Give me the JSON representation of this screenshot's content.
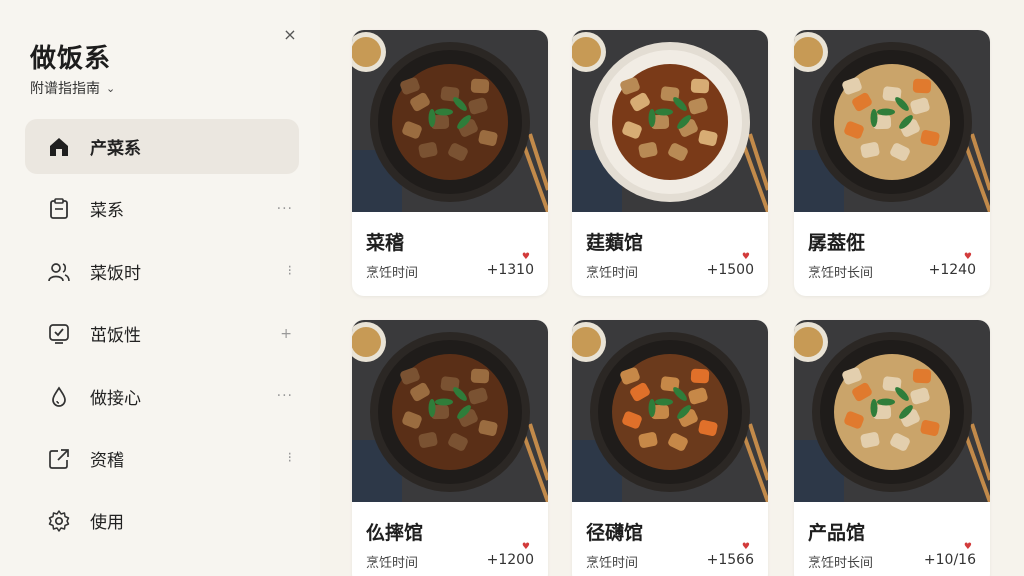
{
  "app": {
    "title": "做饭系",
    "subtitle": "附谱指指南",
    "close_glyph": "×"
  },
  "sidebar": {
    "items": [
      {
        "label": "产菜系",
        "icon": "home-icon",
        "active": true,
        "more": ""
      },
      {
        "label": "菜系",
        "icon": "clipboard-icon",
        "active": false,
        "more": "···"
      },
      {
        "label": "菜饭时",
        "icon": "users-icon",
        "active": false,
        "more": "⁝"
      },
      {
        "label": "茁饭性",
        "icon": "badge-check-icon",
        "active": false,
        "more": "+"
      },
      {
        "label": "做接心",
        "icon": "droplet-icon",
        "active": false,
        "more": "···"
      },
      {
        "label": "资稽",
        "icon": "external-link-icon",
        "active": false,
        "more": "⁝"
      },
      {
        "label": "使用",
        "icon": "gear-icon",
        "active": false,
        "more": ""
      }
    ]
  },
  "cards": [
    {
      "name": "菜稽",
      "meta": "烹饪时间",
      "count": "+1310",
      "dish": "dark"
    },
    {
      "name": "莛蘱馆",
      "meta": "烹饪时间",
      "count": "+1500",
      "dish": "light"
    },
    {
      "name": "孱葢俇",
      "meta": "烹饪时长间",
      "count": "+1240",
      "dish": "chicken"
    },
    {
      "name": "仫摔馆",
      "meta": "烹饪时间",
      "count": "+1200",
      "dish": "dark"
    },
    {
      "name": "径礴馆",
      "meta": "烹饪时间",
      "count": "+1566",
      "dish": "carrot"
    },
    {
      "name": "产品馆",
      "meta": "烹饪时长间",
      "count": "+10/16",
      "dish": "chicken"
    }
  ],
  "colors": {
    "heart": "#d23b3b",
    "active_bg": "#ebe7e0",
    "sidebar_bg": "#f7f5f0",
    "page_bg": "#f6f3ec"
  }
}
